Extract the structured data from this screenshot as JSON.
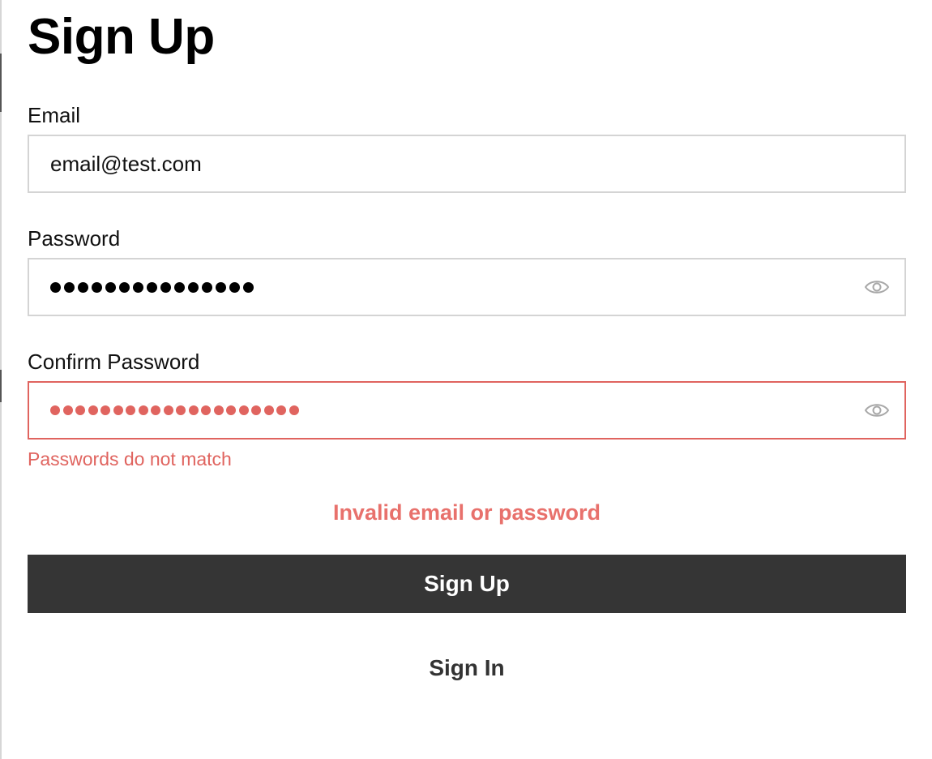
{
  "form": {
    "title": "Sign Up",
    "email": {
      "label": "Email",
      "value": "email@test.com"
    },
    "password": {
      "label": "Password",
      "masked_length": 15,
      "toggle_icon": "eye-icon"
    },
    "confirm_password": {
      "label": "Confirm Password",
      "masked_length": 20,
      "toggle_icon": "eye-icon",
      "error": "Passwords do not match"
    },
    "form_error": "Invalid email or password",
    "submit_label": "Sign Up",
    "secondary_label": "Sign In"
  },
  "colors": {
    "error": "#e0645f",
    "button_bg": "#353535",
    "border": "#d4d4d4"
  }
}
